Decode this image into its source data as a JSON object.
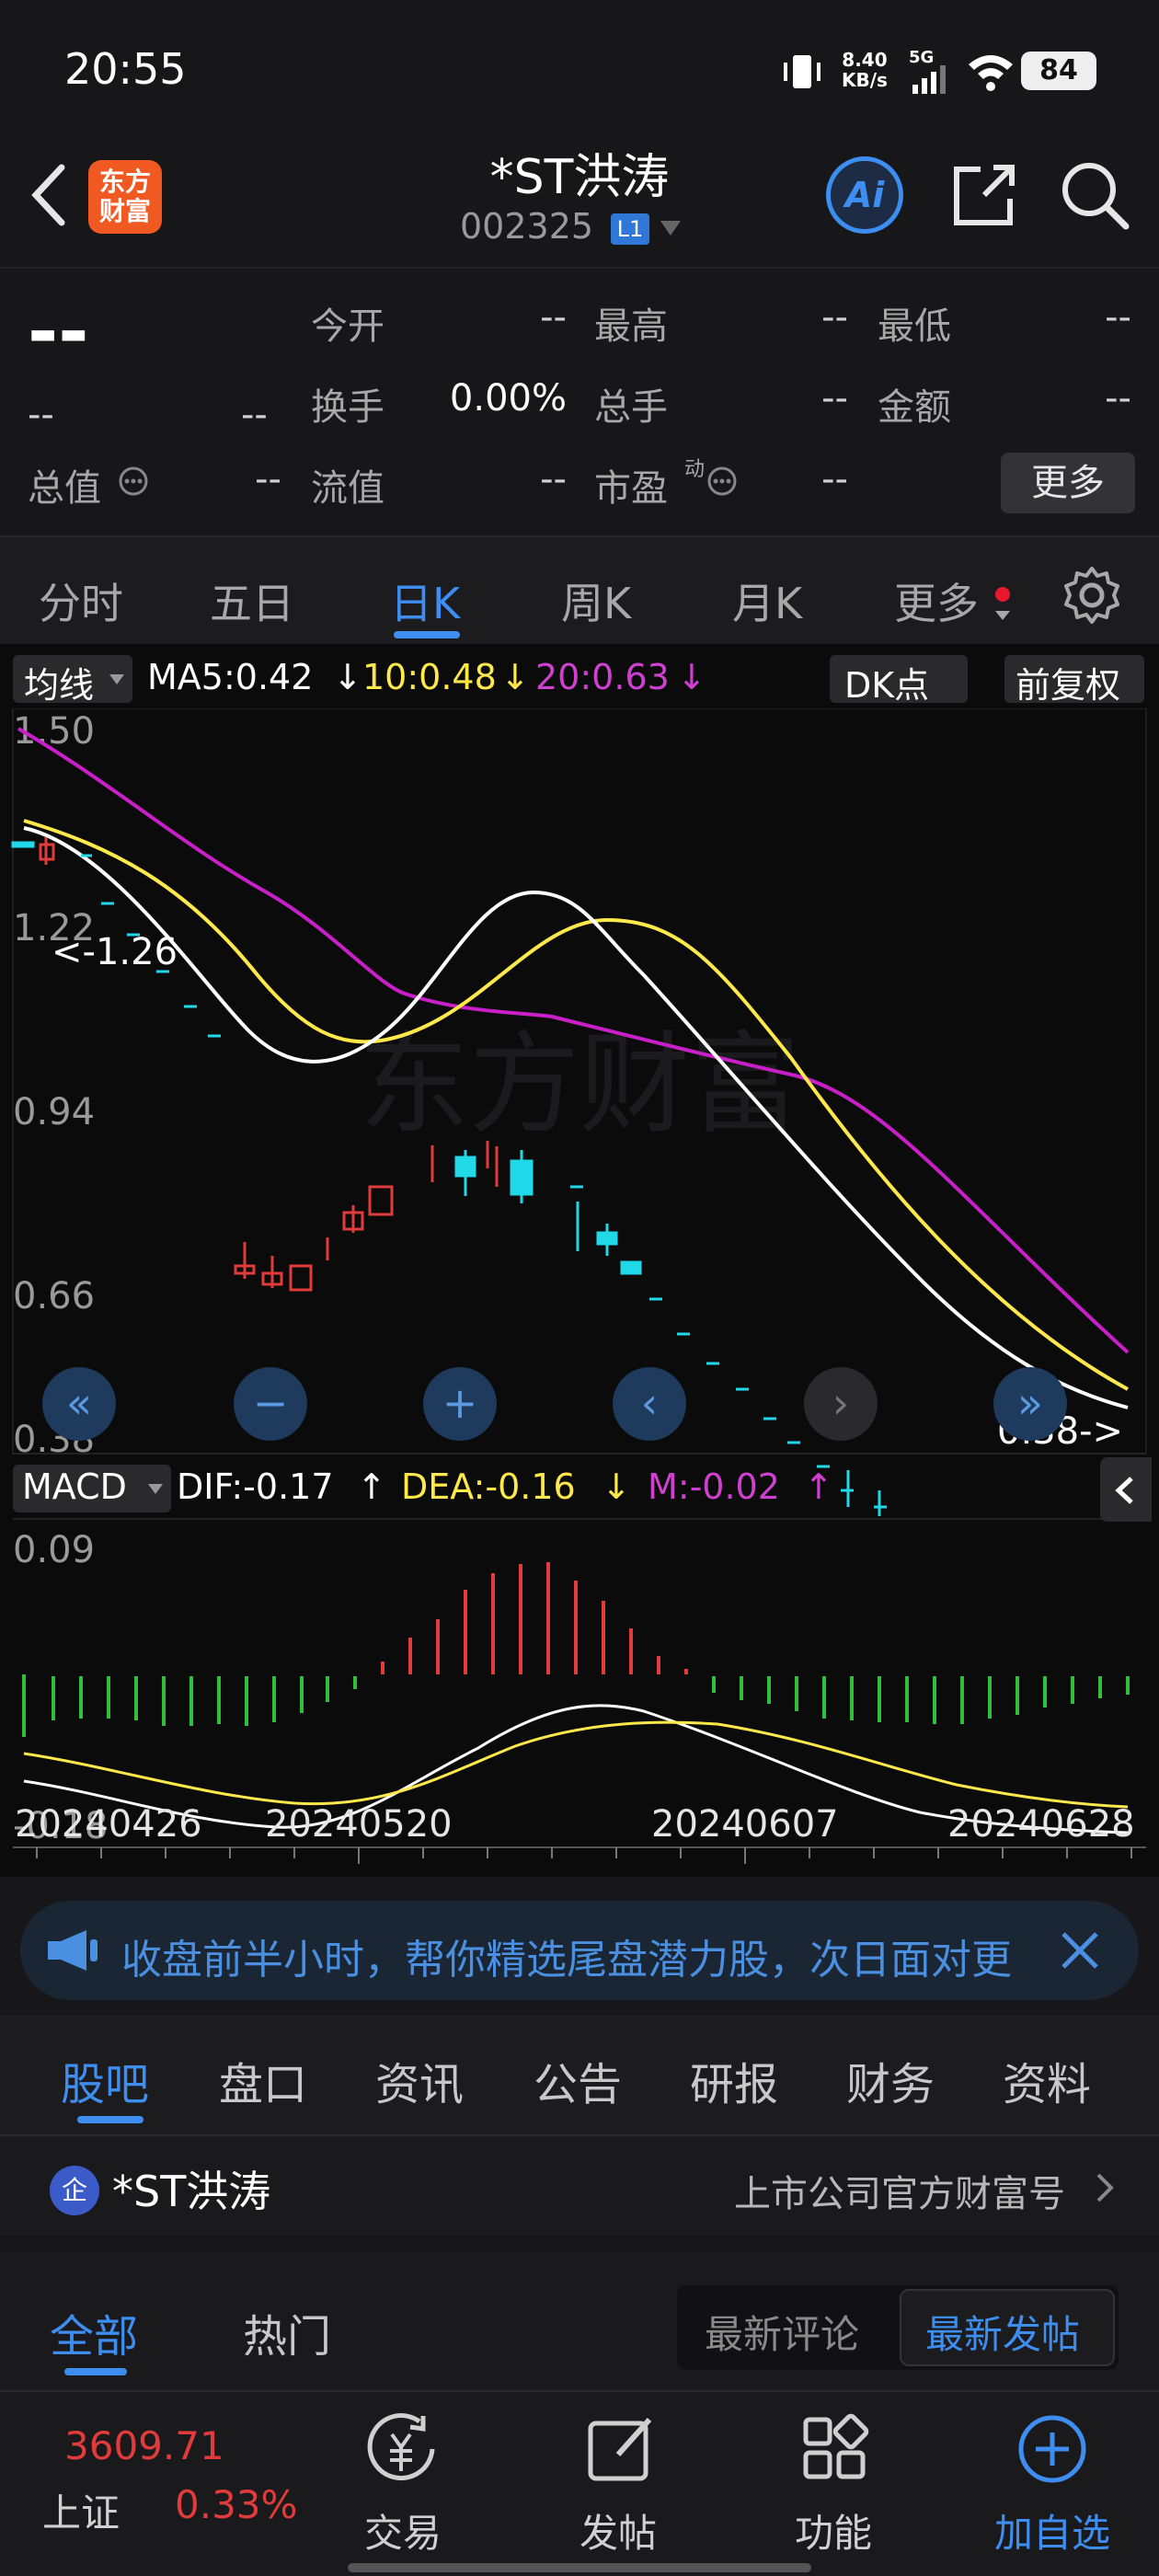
{
  "status_bar": {
    "time": "20:55",
    "net_speed": "8.40",
    "net_speed_unit": "KB/s",
    "network": "5G",
    "battery": "84"
  },
  "header": {
    "title": "*ST洪涛",
    "code": "002325",
    "level_badge": "L1",
    "logo_text_line1": "东方",
    "logo_text_line2": "财富",
    "ai_label": "Ai"
  },
  "quote": {
    "price": "--",
    "change": "--",
    "change_pct": "--",
    "rows": [
      [
        {
          "label": "今开",
          "value": "--"
        },
        {
          "label": "最高",
          "value": "--"
        },
        {
          "label": "最低",
          "value": "--"
        }
      ],
      [
        {
          "label": "换手",
          "value": "0.00%"
        },
        {
          "label": "总手",
          "value": "--"
        },
        {
          "label": "金额",
          "value": "--"
        }
      ],
      [
        {
          "label": "流值",
          "value": "--"
        },
        {
          "label": "市盈",
          "value": "--"
        }
      ]
    ],
    "total_value_label": "总值",
    "total_value": "--",
    "pe_superscript": "动",
    "more_button": "更多"
  },
  "period_tabs": {
    "items": [
      "分时",
      "五日",
      "日K",
      "周K",
      "月K",
      "更多"
    ],
    "active": "日K"
  },
  "kline": {
    "indicator_select": "均线",
    "ma5": "MA5:0.42",
    "ma10": "10:0.48",
    "ma20": "20:0.63",
    "dk_button": "DK点",
    "adjust_button": "前复权",
    "y_ticks": [
      "1.50",
      "1.22",
      "0.94",
      "0.66",
      "0.38"
    ],
    "high_marker": "<-1.26",
    "low_marker": "0.38->",
    "watermark": "东方财富",
    "colors": {
      "ma5": "#ffffff",
      "ma10": "#ffe94a",
      "ma20": "#c81fc8",
      "up": "#e23b3b",
      "down": "#21d8e8"
    }
  },
  "macd": {
    "select": "MACD",
    "dif": "DIF:-0.17",
    "dea": "DEA:-0.16",
    "m": "M:-0.02",
    "y_ticks": [
      "0.09",
      "-0.18"
    ],
    "x_dates": [
      "20240426",
      "20240520",
      "20240607",
      "20240628"
    ]
  },
  "banner": {
    "text": "收盘前半小时，帮你精选尾盘潜力股，次日面对更"
  },
  "info_tabs": {
    "items": [
      "股吧",
      "盘口",
      "资讯",
      "公告",
      "研报",
      "财务",
      "资料"
    ],
    "active": "股吧"
  },
  "company": {
    "name": "*ST洪涛",
    "badge": "企",
    "official": "上市公司官方财富号"
  },
  "feed": {
    "tabs": [
      "全部",
      "热门"
    ],
    "sort": [
      "最新评论",
      "最新发帖"
    ]
  },
  "navbar": {
    "index_value": "3609.71",
    "index_name": "上证",
    "index_change": "0.33%",
    "items": [
      "交易",
      "发帖",
      "功能",
      "加自选"
    ]
  }
}
